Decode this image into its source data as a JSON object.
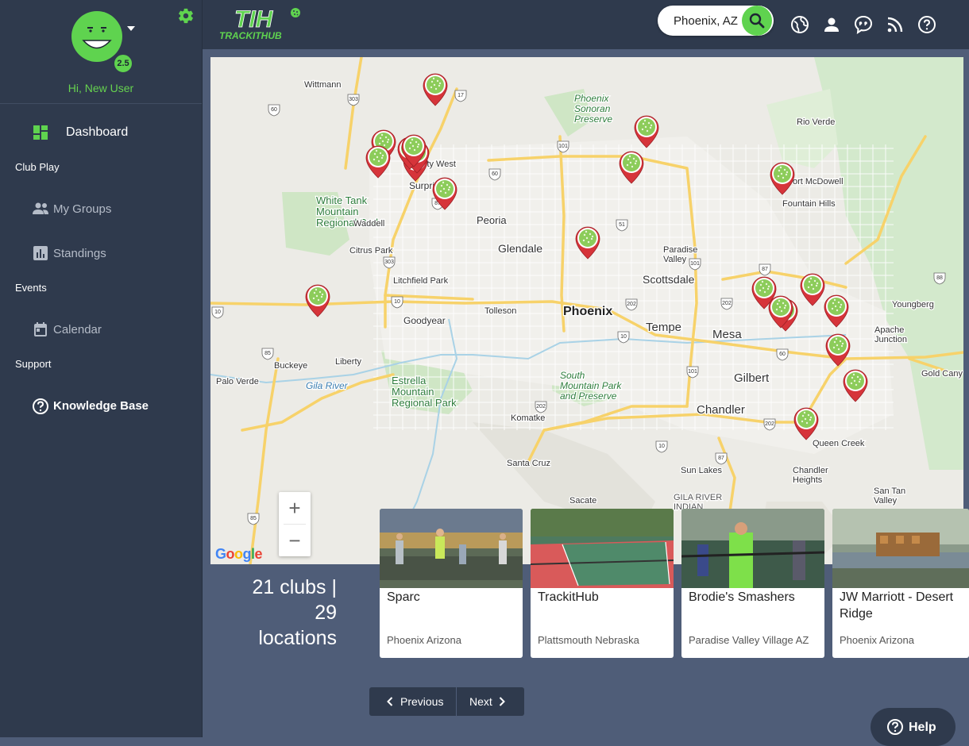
{
  "user": {
    "greeting": "Hi, New User",
    "level": "2.5"
  },
  "sidebar": {
    "dashboard": "Dashboard",
    "sections": {
      "club_play": "Club Play",
      "events": "Events",
      "support": "Support"
    },
    "my_groups": "My Groups",
    "standings": "Standings",
    "calendar": "Calendar",
    "knowledge_base": "Knowledge Base"
  },
  "header": {
    "logo_text": "TIH",
    "logo_subtitle": "TRACKITHUB",
    "search_value": "Phoenix, AZ",
    "icons": [
      "globe-icon",
      "user-icon",
      "chat-quote-icon",
      "rss-icon",
      "help-circle-icon"
    ]
  },
  "map": {
    "place_labels": {
      "wittmann": "Wittmann",
      "phoenix_sonoran": "Phoenix\nSonoran\nPreserve",
      "rio_verde": "Rio Verde",
      "sun_city_west": "ity West",
      "surprise": "Surprise",
      "fort_mcdowell": "ort McDowell",
      "fountain_hills": "Fountain Hills",
      "white_tank": "White Tank\nMountain\nRegional Park",
      "waddell": "Waddell",
      "peoria": "Peoria",
      "glendale": "Glendale",
      "paradise_valley": "Paradise\nValley",
      "citrus_park": "Citrus Park",
      "scottsdale": "Scottsdale",
      "litchfield_park": "Litchfield Park",
      "youngberg": "Youngberg",
      "tolleson": "Tolleson",
      "phoenix": "Phoenix",
      "tempe": "Tempe",
      "mesa": "Mesa",
      "goodyear": "Goodyear",
      "apache_junction": "Apache\nJunction",
      "liberty": "Liberty",
      "buckeye": "Buckeye",
      "palo_verde": "Palo Verde",
      "gila_river": "Gila River",
      "estrella": "Estrella\nMountain\nRegional Park",
      "south_mountain": "South\nMountain Park\nand Preserve",
      "gilbert": "Gilbert",
      "gold_canyon": "Gold Cany",
      "komatke": "Komatke",
      "chandler": "Chandler",
      "queen_creek": "Queen Creek",
      "santa_cruz": "Santa Cruz",
      "sun_lakes": "Sun Lakes",
      "chandler_heights": "Chandler\nHeights",
      "sacate": "Sacate",
      "gila_river_indian": "GILA RIVER\nINDIAN",
      "san_tan_valley": "San Tan\nValley"
    },
    "highway_shields": [
      "303",
      "60",
      "17",
      "101",
      "60",
      "87",
      "51",
      "101",
      "87",
      "303",
      "10",
      "10",
      "202",
      "202",
      "88",
      "85",
      "10",
      "60",
      "101",
      "202",
      "202",
      "10",
      "87",
      "85"
    ],
    "zoom_in": "+",
    "zoom_out": "−",
    "attribution": "Google",
    "pin_count_visible": 21
  },
  "summary": {
    "line1": "21 clubs |",
    "line2": "29",
    "line3": "locations"
  },
  "clubs": [
    {
      "name": "Sparc",
      "location": "Phoenix Arizona"
    },
    {
      "name": "TrackitHub",
      "location": "Plattsmouth Nebraska"
    },
    {
      "name": "Brodie's Smashers",
      "location": "Paradise Valley Village AZ"
    },
    {
      "name": "JW Marriott - Desert Ridge",
      "location": "Phoenix Arizona"
    }
  ],
  "pager": {
    "previous": "Previous",
    "next": "Next"
  },
  "help_button": "Help",
  "colors": {
    "sidebar": "#2f3a4d",
    "accent_green": "#5fd34f",
    "page_bg": "#4f5d78",
    "pin_red": "#d6343a"
  }
}
